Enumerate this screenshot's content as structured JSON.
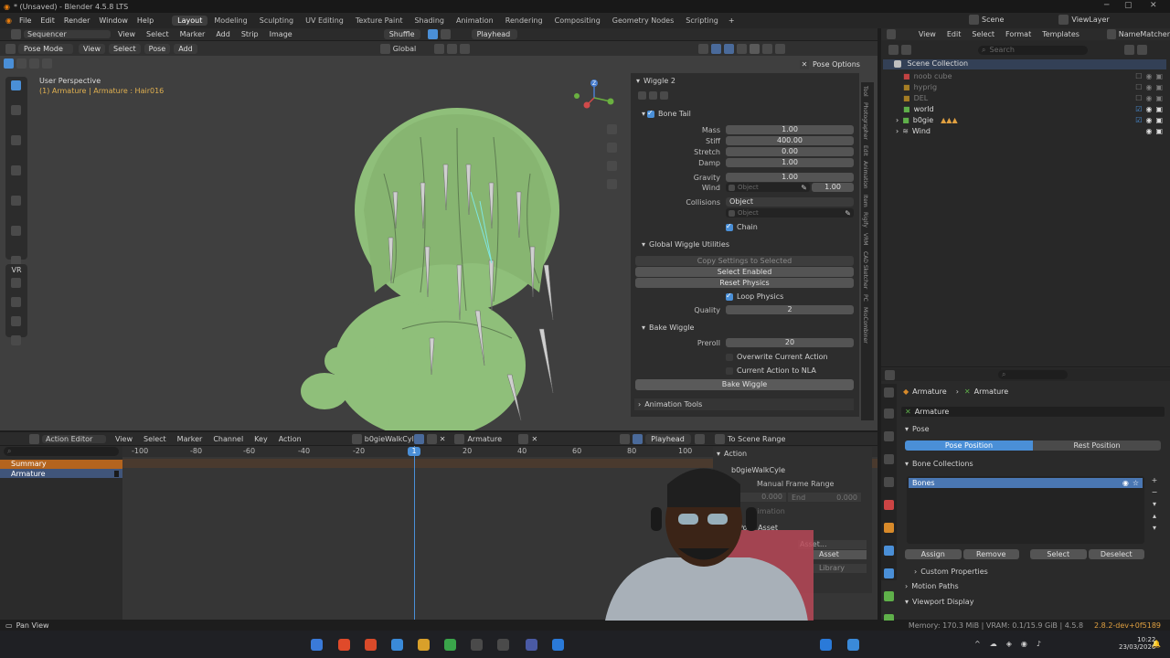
{
  "window": {
    "title": "* (Unsaved) - Blender 4.5.8 LTS"
  },
  "menu": {
    "items": [
      "File",
      "Edit",
      "Render",
      "Window",
      "Help"
    ]
  },
  "workspaces": [
    "Layout",
    "Modeling",
    "Sculpting",
    "UV Editing",
    "Texture Paint",
    "Shading",
    "Animation",
    "Rendering",
    "Compositing",
    "Geometry Nodes",
    "Scripting"
  ],
  "topright": {
    "scene": "Scene",
    "view_layer": "ViewLayer",
    "namematcher": "NameMatcher"
  },
  "sequencer": {
    "editor": "Sequencer",
    "menus": [
      "View",
      "Select",
      "Marker",
      "Add",
      "Strip",
      "Image"
    ],
    "shuffle": "Shuffle",
    "playhead": "Playhead"
  },
  "viewport": {
    "mode": "Pose Mode",
    "menus": [
      "View",
      "Select",
      "Pose",
      "Add"
    ],
    "orientation": "Global",
    "perspective": "User Perspective",
    "object_info": "(1) Armature | Armature : Hair016",
    "pose_options": "Pose Options",
    "vr": "VR",
    "gizmo_z": "Z"
  },
  "wiggle": {
    "title": "Wiggle 2",
    "bone_tail": "Bone Tail",
    "mass_label": "Mass",
    "mass": "1.00",
    "stiff_label": "Stiff",
    "stiff": "400.00",
    "stretch_label": "Stretch",
    "stretch": "0.00",
    "damp_label": "Damp",
    "damp": "1.00",
    "gravity_label": "Gravity",
    "gravity": "1.00",
    "wind_label": "Wind",
    "wind_placeholder": "Object",
    "wind_value": "1.00",
    "collisions_label": "Collisions",
    "collisions_value": "Object",
    "collisions_placeholder": "Object",
    "chain": "Chain",
    "global_utils": "Global Wiggle Utilities",
    "copy_settings": "Copy Settings to Selected",
    "select_enabled": "Select Enabled",
    "reset_physics": "Reset Physics",
    "loop_physics": "Loop Physics",
    "quality_label": "Quality",
    "quality": "2",
    "bake_wiggle_section": "Bake Wiggle",
    "preroll_label": "Preroll",
    "preroll": "20",
    "overwrite": "Overwrite Current Action",
    "current_to_nla": "Current Action to NLA",
    "bake_button": "Bake Wiggle",
    "animation_tools": "Animation Tools"
  },
  "side_tabs": [
    "Tool",
    "Photographer",
    "Edit",
    "Animation",
    "Item",
    "Rigify",
    "VRM",
    "CAD Sketcher",
    "PC",
    "MioCombiner"
  ],
  "outliner": {
    "search_placeholder": "Search",
    "menus": [
      "View",
      "Edit",
      "Select",
      "Format",
      "Templates"
    ],
    "root": "Scene Collection",
    "items": [
      {
        "name": "noob cube",
        "dim": true
      },
      {
        "name": "hyprig",
        "dim": true
      },
      {
        "name": "DEL",
        "dim": true
      },
      {
        "name": "world",
        "dim": false
      },
      {
        "name": "b0gie",
        "dim": false
      },
      {
        "name": "Wind",
        "dim": false
      }
    ]
  },
  "properties": {
    "breadcrumb_a": "Armature",
    "breadcrumb_b": "Armature",
    "object_name": "Armature",
    "pose": "Pose",
    "pose_position": "Pose Position",
    "rest_position": "Rest Position",
    "bone_collections": "Bone Collections",
    "bones_item": "Bones",
    "assign": "Assign",
    "remove": "Remove",
    "select": "Select",
    "deselect": "Deselect",
    "custom_props": "Custom Properties",
    "motion_paths": "Motion Paths",
    "viewport_display": "Viewport Display"
  },
  "action_editor": {
    "editor": "Action Editor",
    "menus": [
      "View",
      "Select",
      "Marker",
      "Channel",
      "Key",
      "Action"
    ],
    "action_name": "b0gieWalkCyle",
    "object": "Armature",
    "playhead": "Playhead",
    "to_scene_range": "To Scene Range",
    "summary": "Summary",
    "armature": "Armature",
    "ruler": [
      "-100",
      "-80",
      "-60",
      "-40",
      "-20",
      "1",
      "20",
      "40",
      "60",
      "80",
      "100"
    ],
    "current_frame": "1",
    "action_panel": "Action",
    "action_panel_name": "b0gieWalkCyle",
    "manual_frame_range": "Manual Frame Range",
    "start_value": "0.000",
    "end_label": "End",
    "end_value": "0.000",
    "animation_label": "Animation",
    "pose_asset": "Pose Asset",
    "asset": "Asset...",
    "asset2": "Asset",
    "library": "Library"
  },
  "statusbar": {
    "left": "Pan View",
    "right": "Memory: 170.3 MiB | VRAM: 0.1/15.9 GiB | 4.5.8",
    "extra": "2.8.2-dev+0f5189"
  },
  "taskbar": {
    "time": "10:22",
    "date": "23/03/2026"
  },
  "colors": {
    "accent": "#4a8fd7",
    "mesh": "#8fbf7a",
    "summary": "#b4641e",
    "header": "#2b2b2b"
  }
}
